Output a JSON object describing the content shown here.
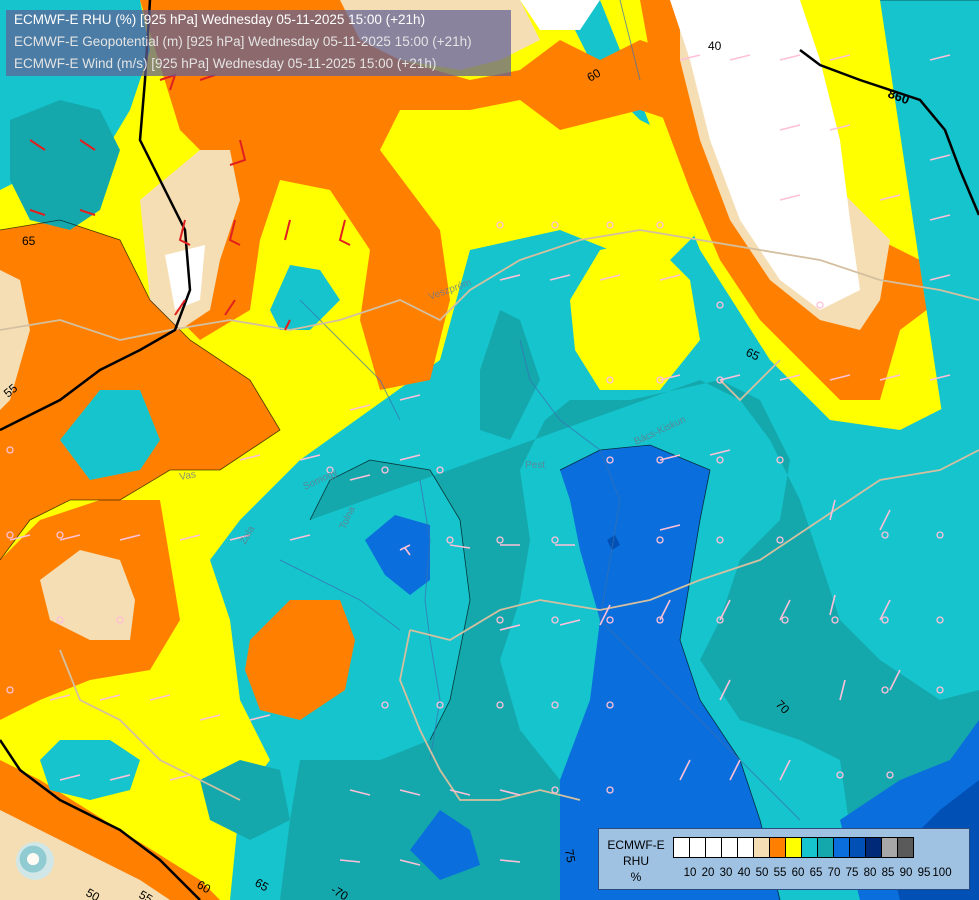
{
  "titles": {
    "rhu": "ECMWF-E RHU (%) [925 hPa] Wednesday 05-11-2025 15:00 (+21h)",
    "geopotential": "ECMWF-E Geopotential (m) [925 hPa] Wednesday 05-11-2025 15:00 (+21h)",
    "wind": "ECMWF-E Wind (m/s) [925 hPa] Wednesday 05-11-2025 15:00 (+21h)"
  },
  "contour_labels": {
    "rhu_65_nw": "65",
    "rhu_55_w": "55",
    "rhu_60_top": "60",
    "rhu_40_ne": "40",
    "rhu_65_e": "65",
    "rhu_70_se": "70",
    "rhu_75_s": "75",
    "rhu_50_sw": "50",
    "rhu_55_sw": "55",
    "rhu_60_sw": "60",
    "rhu_65_sw": "65",
    "rhu_70_sw": "-70",
    "geopotential_860": "860"
  },
  "place_labels": [
    "Vas",
    "Somogy",
    "Tolna",
    "Veszprém",
    "Pest",
    "Bács-Kiskun",
    "Zala"
  ],
  "legend": {
    "title_lines": [
      "ECMWF-E",
      "RHU",
      "%"
    ],
    "ticks": [
      "10",
      "20",
      "30",
      "40",
      "50",
      "55",
      "60",
      "65",
      "70",
      "75",
      "80",
      "85",
      "90",
      "95",
      "100"
    ],
    "colors": [
      "#ffffff",
      "#ffffff",
      "#ffffff",
      "#ffffff",
      "#ffffff",
      "#f5deb3",
      "#ff8000",
      "#ffff00",
      "#15c4cc",
      "#14a8ad",
      "#0a6fdc",
      "#0050b5",
      "#002a77",
      "#a8a8a8",
      "#5a5a5a"
    ]
  },
  "map_colors": {
    "rh_50_55": "#f5deb3",
    "rh_55_60": "#ff8000",
    "rh_60_65": "#ffff00",
    "rh_65_70": "#15c4cc",
    "rh_70_75": "#14a8ad",
    "rh_75_80": "#0a6fdc",
    "rh_80_85": "#0050b5",
    "border": "#d4c0a0",
    "river": "#3a6fb0",
    "wind_barb": "#ffc0d8",
    "wind_barb_strong": "#e02020",
    "geopotential_line": "#000000"
  }
}
